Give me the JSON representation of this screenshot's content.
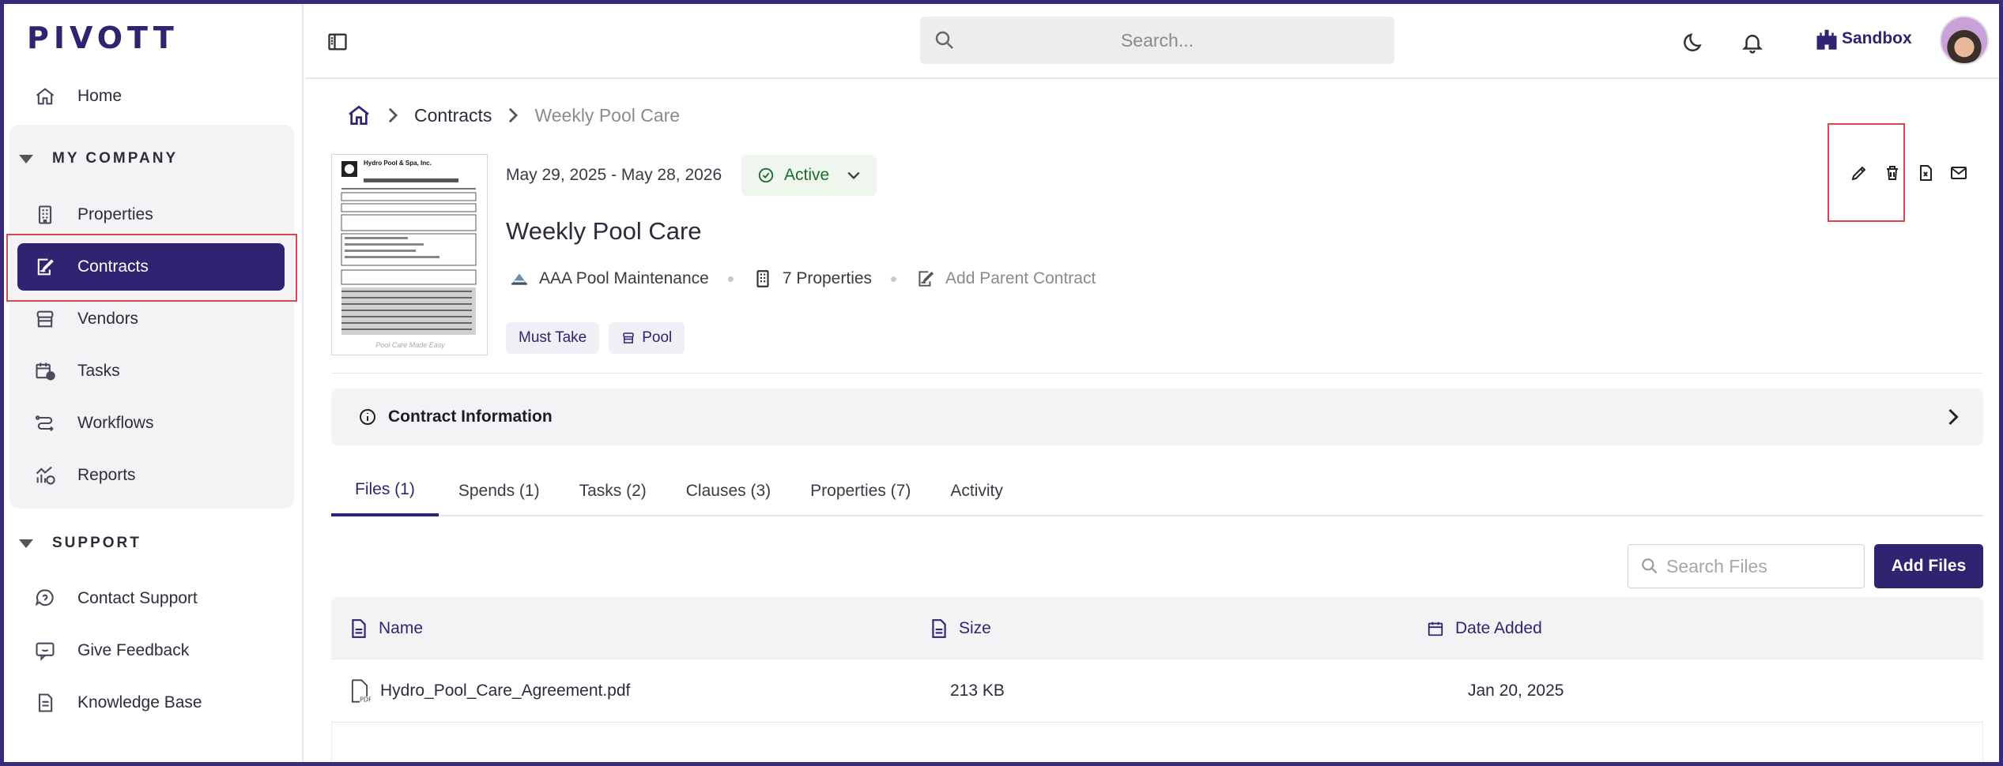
{
  "app": {
    "logo": "PIVOTT",
    "search_placeholder": "Search...",
    "workspace": "Sandbox"
  },
  "sidebar": {
    "home": "Home",
    "my_company_heading": "MY COMPANY",
    "company_items": [
      "Properties",
      "Contracts",
      "Vendors",
      "Tasks",
      "Workflows",
      "Reports"
    ],
    "active_item": "Contracts",
    "support_heading": "SUPPORT",
    "support_items": [
      "Contact Support",
      "Give Feedback",
      "Knowledge Base"
    ]
  },
  "breadcrumb": {
    "section": "Contracts",
    "current": "Weekly Pool Care"
  },
  "contract": {
    "dates": "May 29, 2025 - May 28, 2026",
    "status": "Active",
    "title": "Weekly Pool Care",
    "vendor": "AAA Pool Maintenance",
    "properties": "7 Properties",
    "parent_link": "Add Parent Contract",
    "tags": [
      "Must Take",
      "Pool"
    ],
    "doc_thumb_header": "Hydro Pool & Spa, Inc.",
    "doc_thumb_footer": "Pool Care Made Easy"
  },
  "info_section": {
    "label": "Contract Information"
  },
  "tabs": [
    "Files (1)",
    "Spends (1)",
    "Tasks (2)",
    "Clauses (3)",
    "Properties (7)",
    "Activity"
  ],
  "active_tab": "Files (1)",
  "files": {
    "search_placeholder": "Search Files",
    "add_button": "Add Files",
    "columns": [
      "Name",
      "Size",
      "Date Added"
    ],
    "rows": [
      {
        "name": "Hydro_Pool_Care_Agreement.pdf",
        "size": "213 KB",
        "date": "Jan 20, 2025"
      }
    ]
  },
  "colors": {
    "brand": "#2e2472",
    "status_bg": "#eef6ee",
    "status_text": "#1f6b2f",
    "highlight_box": "#e0454e"
  },
  "icons": {
    "actions": [
      "edit-icon",
      "delete-icon",
      "export-icon",
      "email-icon"
    ]
  }
}
